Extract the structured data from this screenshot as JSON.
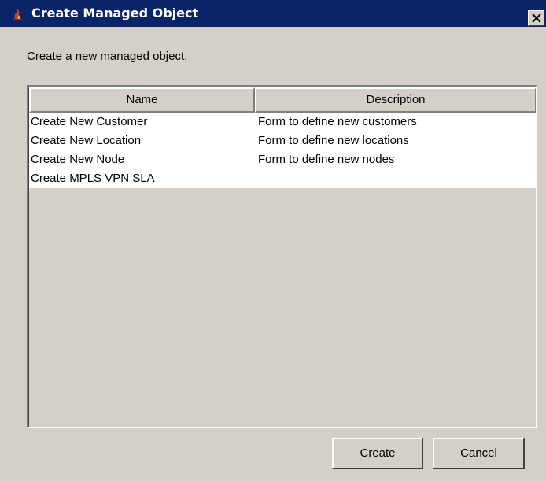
{
  "window": {
    "title": "Create Managed Object",
    "icon": "java-app-icon",
    "close_icon": "close-icon"
  },
  "dialog": {
    "description": "Create a new managed object."
  },
  "table": {
    "columns": [
      "Name",
      "Description"
    ],
    "rows": [
      {
        "name": "Create New Customer",
        "description": "Form to define new customers"
      },
      {
        "name": "Create New Location",
        "description": "Form to define new locations"
      },
      {
        "name": "Create New Node",
        "description": "Form to define new nodes"
      },
      {
        "name": "Create MPLS VPN SLA",
        "description": ""
      }
    ]
  },
  "buttons": {
    "create_label": "Create",
    "cancel_label": "Cancel"
  },
  "colors": {
    "titlebar": "#0a246a",
    "dialog_bg": "#d4d0c8",
    "list_bg": "#ffffff"
  }
}
